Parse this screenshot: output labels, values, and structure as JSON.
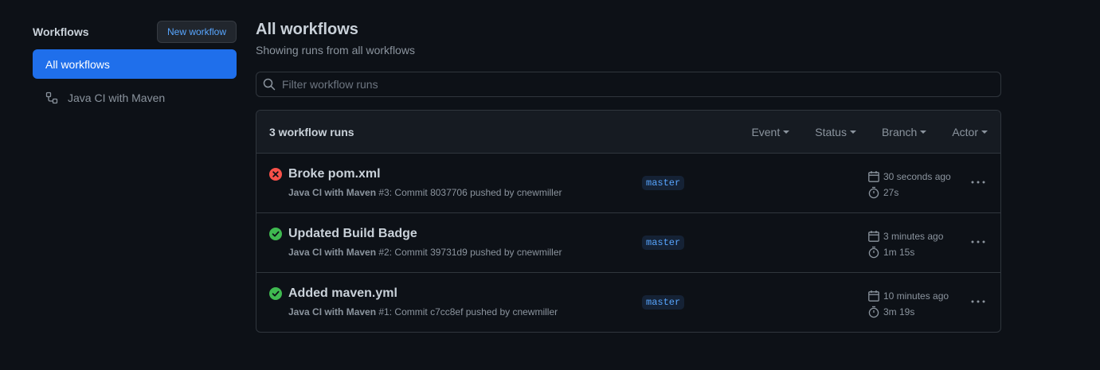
{
  "sidebar": {
    "title": "Workflows",
    "new_button": "New workflow",
    "items": [
      {
        "label": "All workflows"
      },
      {
        "label": "Java CI with Maven"
      }
    ]
  },
  "main": {
    "title": "All workflows",
    "subtitle": "Showing runs from all workflows",
    "filter_placeholder": "Filter workflow runs"
  },
  "runs": {
    "count_label": "3 workflow runs",
    "filters": [
      "Event",
      "Status",
      "Branch",
      "Actor"
    ],
    "items": [
      {
        "status": "failure",
        "title": "Broke pom.xml",
        "workflow": "Java CI with Maven",
        "detail": " #3: Commit 8037706 pushed by cnewmiller",
        "branch": "master",
        "ago": "30 seconds ago",
        "duration": "27s"
      },
      {
        "status": "success",
        "title": "Updated Build Badge",
        "workflow": "Java CI with Maven",
        "detail": " #2: Commit 39731d9 pushed by cnewmiller",
        "branch": "master",
        "ago": "3 minutes ago",
        "duration": "1m 15s"
      },
      {
        "status": "success",
        "title": "Added maven.yml",
        "workflow": "Java CI with Maven",
        "detail": " #1: Commit c7cc8ef pushed by cnewmiller",
        "branch": "master",
        "ago": "10 minutes ago",
        "duration": "3m 19s"
      }
    ]
  },
  "colors": {
    "failure": "#f85149",
    "success": "#3fb950",
    "accent": "#1f6feb",
    "link": "#58a6ff"
  }
}
